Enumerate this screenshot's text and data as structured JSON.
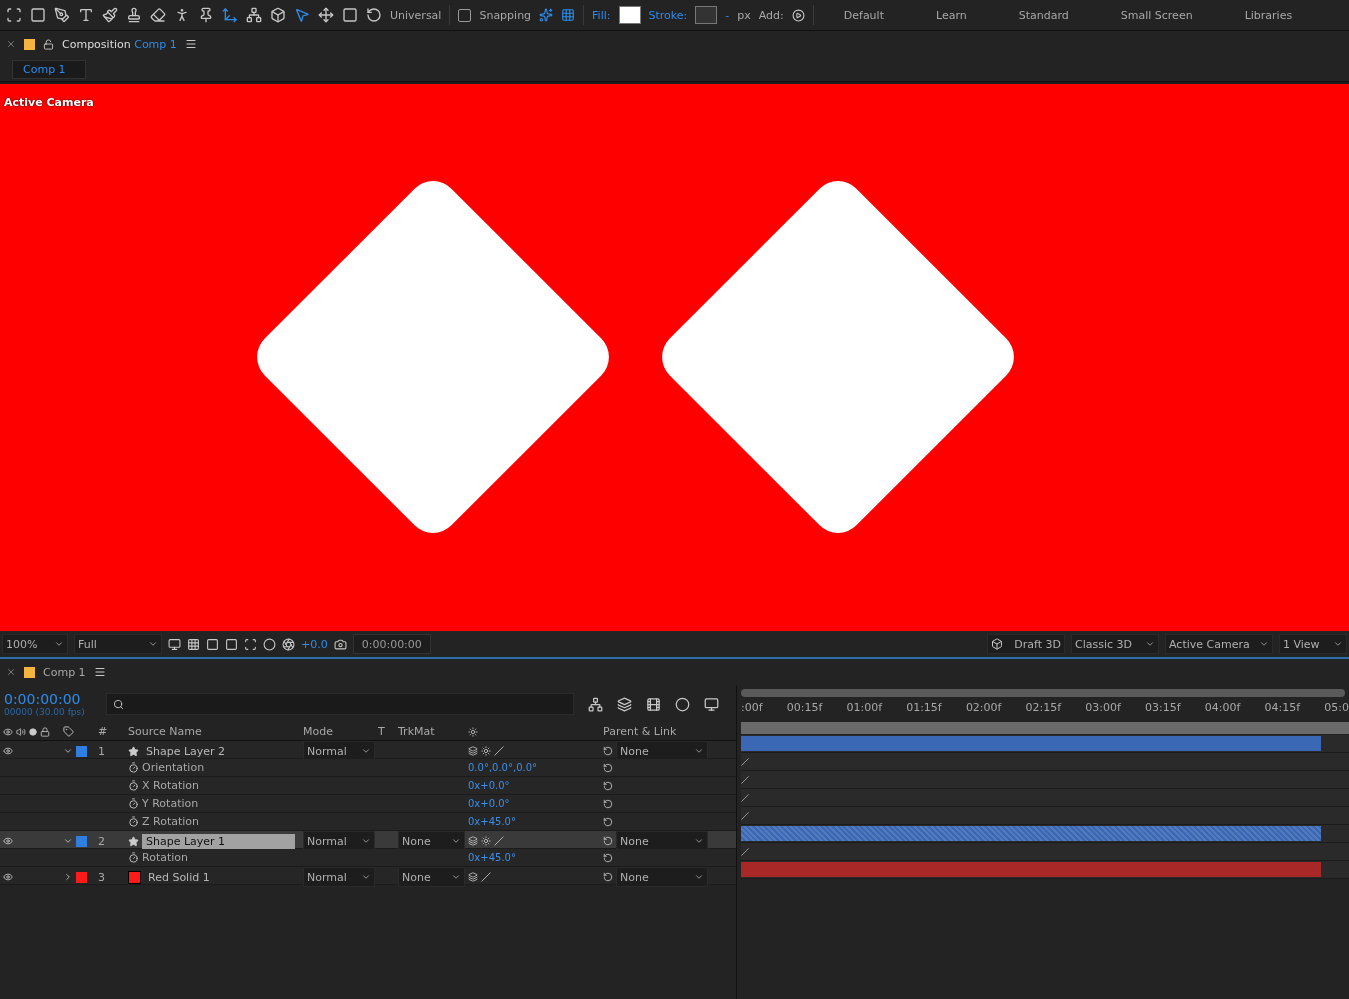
{
  "toolbar": {
    "universal": "Universal",
    "snapping": {
      "label": "Snapping",
      "checked": false
    },
    "fill_label": "Fill:",
    "stroke_label": "Stroke:",
    "stroke_width": "-",
    "unit": "px",
    "add_label": "Add:",
    "workspaces": [
      {
        "label": "Default",
        "selected": false
      },
      {
        "label": "Learn",
        "selected": false
      },
      {
        "label": "Standard",
        "selected": false
      },
      {
        "label": "Small Screen",
        "selected": false
      },
      {
        "label": "Libraries",
        "selected": false
      }
    ]
  },
  "composition_panel": {
    "title": "Composition",
    "comp_name": "Comp 1",
    "tabs": [
      {
        "label": "Comp 1",
        "selected": true
      }
    ],
    "viewer_label": "Active Camera"
  },
  "viewer_bar": {
    "zoom": "100%",
    "resolution": "Full",
    "exposure": "+0.0",
    "timecode": "0:00:00:00",
    "draft": "Draft 3D",
    "renderer": "Classic 3D",
    "view": "Active Camera",
    "layout": "1 View"
  },
  "timeline": {
    "tab": "Comp 1",
    "timecode": "0:00:00:00",
    "frames": "00000 (30.00 fps)",
    "columns": {
      "number": "#",
      "source_name": "Source Name",
      "mode": "Mode",
      "t": "T",
      "trkmat": "TrkMat",
      "parent": "Parent & Link"
    },
    "ruler": [
      ":00f",
      "00:15f",
      "01:00f",
      "01:15f",
      "02:00f",
      "02:15f",
      "03:00f",
      "03:15f",
      "04:00f",
      "04:15f",
      "05:0"
    ],
    "layers": [
      {
        "number": "1",
        "kind": "shape",
        "name": "Shape Layer 2",
        "color": "#2f7fe0",
        "expanded": true,
        "selected": false,
        "mode": "Normal",
        "parent": "None",
        "children": [
          {
            "name": "Orientation",
            "value": "0.0°,0.0°,0.0°"
          },
          {
            "name": "X Rotation",
            "value": "0x+0.0°"
          },
          {
            "name": "Y Rotation",
            "value": "0x+0.0°"
          },
          {
            "name": "Z Rotation",
            "value": "0x+45.0°"
          }
        ]
      },
      {
        "number": "2",
        "kind": "shape",
        "name": "Shape Layer 1",
        "color": "#2f7fe0",
        "expanded": true,
        "selected": true,
        "mode": "Normal",
        "trkmat": "None",
        "parent": "None",
        "children": [
          {
            "name": "Rotation",
            "value": "0x+45.0°"
          }
        ]
      },
      {
        "number": "3",
        "kind": "solid",
        "name": "Red Solid 1",
        "color": "#ff1a1a",
        "expanded": false,
        "selected": false,
        "mode": "Normal",
        "trkmat": "None",
        "parent": "None"
      }
    ]
  }
}
